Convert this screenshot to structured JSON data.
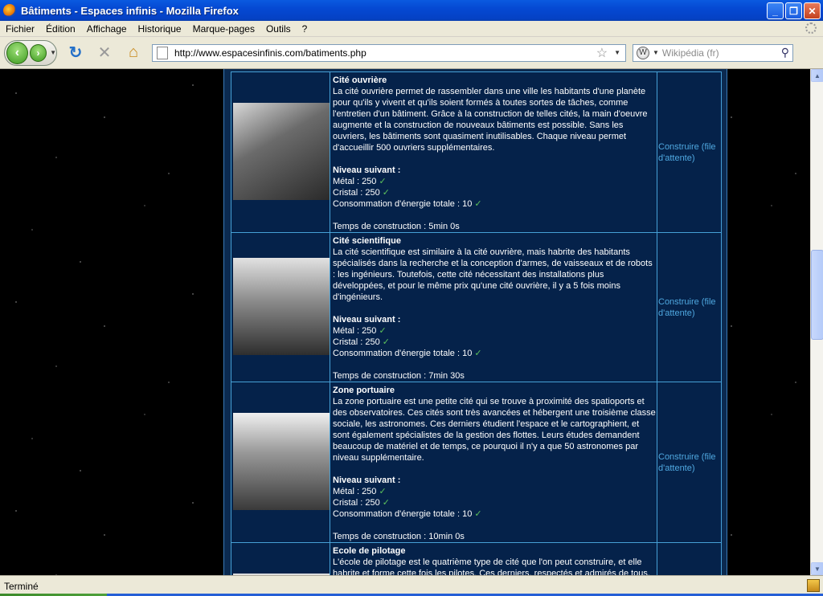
{
  "window": {
    "title": "Bâtiments - Espaces infinis - Mozilla Firefox",
    "minimize_glyph": "_",
    "restore_glyph": "❐",
    "close_glyph": "✕"
  },
  "menu": [
    "Fichier",
    "Édition",
    "Affichage",
    "Historique",
    "Marque-pages",
    "Outils",
    "?"
  ],
  "toolbar": {
    "url": "http://www.espacesinfinis.com/batiments.php",
    "search_placeholder": "Wikipédia (fr)",
    "back_glyph": "‹",
    "forward_glyph": "›",
    "reload_glyph": "↻",
    "stop_glyph": "✕",
    "home_glyph": "⌂"
  },
  "buildings": [
    {
      "name": "Cité ouvrière",
      "description": "La cité ouvrière permet de rassembler dans une ville les habitants d'une planète pour qu'ils y vivent et qu'ils soient formés à toutes sortes de tâches, comme l'entretien d'un bâtiment. Grâce à la construction de telles cités, la main d'oeuvre augmente et la construction de nouveaux bâtiments est possible. Sans les ouvriers, les bâtiments sont quasiment inutilisables. Chaque niveau permet d'accueillir 500 ouvriers supplémentaires.",
      "next_level_label": "Niveau suivant :",
      "metal": "Métal : 250",
      "cristal": "Cristal : 250",
      "energy": "Consommation d'énergie totale : 10",
      "time": "Temps de construction : 5min 0s",
      "action": "Construire (file d'attente)"
    },
    {
      "name": "Cité scientifique",
      "description": "La cité scientifique est similaire à la cité ouvrière, mais habrite des habitants spécialisés dans la recherche et la conception d'armes, de vaisseaux et de robots : les ingénieurs. Toutefois, cette cité nécessitant des installations plus développées, et pour le même prix qu'une cité ouvrière, il y a 5 fois moins d'ingénieurs.",
      "next_level_label": "Niveau suivant :",
      "metal": "Métal : 250",
      "cristal": "Cristal : 250",
      "energy": "Consommation d'énergie totale : 10",
      "time": "Temps de construction : 7min 30s",
      "action": "Construire (file d'attente)"
    },
    {
      "name": "Zone portuaire",
      "description": "La zone portuaire est une petite cité qui se trouve à proximité des spatioports et des observatoires. Ces cités sont très avancées et hébergent une troisième classe sociale, les astronomes. Ces derniers étudient l'espace et le cartographient, et sont également spécialistes de la gestion des flottes. Leurs études demandent beaucoup de matériel et de temps, ce pourquoi il n'y a que 50 astronomes par niveau supplémentaire.",
      "next_level_label": "Niveau suivant :",
      "metal": "Métal : 250",
      "cristal": "Cristal : 250",
      "energy": "Consommation d'énergie totale : 10",
      "time": "Temps de construction : 10min 0s",
      "action": "Construire (file d'attente)"
    },
    {
      "name": "Ecole de pilotage",
      "description": "L'école de pilotage est le quatrième type de cité que l'on peut construire, et elle habrite et forme cette fois les pilotes. Ces derniers, respectés et admirés de tous,"
    }
  ],
  "check_glyph": "✓",
  "status": "Terminé"
}
